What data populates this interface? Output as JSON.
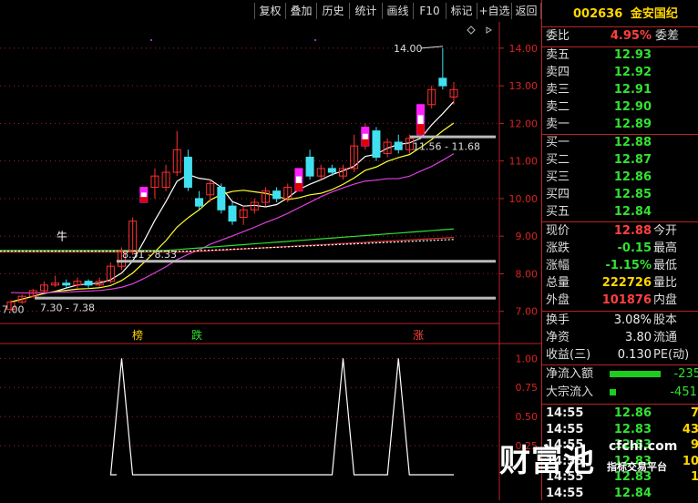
{
  "toolbar": {
    "buttons": [
      "复权",
      "叠加",
      "历史",
      "统计",
      "画线",
      "F10",
      "标记",
      "+自选",
      "返回"
    ]
  },
  "chart": {
    "price_axis": [
      "14.00",
      "13.00",
      "12.00",
      "11.00",
      "10.00",
      "9.00",
      "8.00",
      "7.00"
    ],
    "indicator_axis": [
      "1.00",
      "0.75",
      "0.50",
      "0.25"
    ],
    "annotations": {
      "high": "14.00",
      "box1": "11.56 - 11.68",
      "box2": "8.31 - 8.33",
      "box3": "7.30 - 7.38",
      "low": "7.00"
    },
    "markers": {
      "niu": "牛",
      "bang": "榜",
      "die": "跌",
      "zhang": "涨"
    },
    "candles": [
      {
        "o": 7.05,
        "c": 7.25,
        "h": 7.3,
        "l": 7.0,
        "type": "up"
      },
      {
        "o": 7.25,
        "c": 7.4,
        "h": 7.45,
        "l": 7.2,
        "type": "up"
      },
      {
        "o": 7.4,
        "c": 7.55,
        "h": 7.6,
        "l": 7.35,
        "type": "up"
      },
      {
        "o": 7.55,
        "c": 7.7,
        "h": 7.8,
        "l": 7.5,
        "type": "up"
      },
      {
        "o": 7.7,
        "c": 7.75,
        "h": 7.95,
        "l": 7.65,
        "type": "up"
      },
      {
        "o": 7.75,
        "c": 7.7,
        "h": 7.85,
        "l": 7.6,
        "type": "down"
      },
      {
        "o": 7.7,
        "c": 7.8,
        "h": 7.9,
        "l": 7.6,
        "type": "up"
      },
      {
        "o": 7.8,
        "c": 7.7,
        "h": 7.85,
        "l": 7.6,
        "type": "down"
      },
      {
        "o": 7.7,
        "c": 7.8,
        "h": 7.9,
        "l": 7.65,
        "type": "up"
      },
      {
        "o": 7.8,
        "c": 8.2,
        "h": 8.3,
        "l": 7.75,
        "type": "up"
      },
      {
        "o": 8.2,
        "c": 8.6,
        "h": 8.7,
        "l": 8.1,
        "type": "up"
      },
      {
        "o": 8.6,
        "c": 9.4,
        "h": 9.5,
        "l": 8.5,
        "type": "up"
      },
      {
        "o": 9.9,
        "c": 10.3,
        "h": 10.3,
        "l": 9.9,
        "type": "limit"
      },
      {
        "o": 10.3,
        "c": 10.6,
        "h": 10.8,
        "l": 10.0,
        "type": "up"
      },
      {
        "o": 10.3,
        "c": 10.7,
        "h": 10.9,
        "l": 10.2,
        "type": "up"
      },
      {
        "o": 10.7,
        "c": 11.3,
        "h": 11.8,
        "l": 10.6,
        "type": "up"
      },
      {
        "o": 11.1,
        "c": 10.3,
        "h": 11.3,
        "l": 10.2,
        "type": "down"
      },
      {
        "o": 10.0,
        "c": 9.8,
        "h": 10.2,
        "l": 9.7,
        "type": "down"
      },
      {
        "o": 10.1,
        "c": 10.4,
        "h": 10.5,
        "l": 9.9,
        "type": "up"
      },
      {
        "o": 10.3,
        "c": 9.7,
        "h": 10.4,
        "l": 9.6,
        "type": "down"
      },
      {
        "o": 9.8,
        "c": 9.4,
        "h": 9.9,
        "l": 9.3,
        "type": "down"
      },
      {
        "o": 9.5,
        "c": 9.7,
        "h": 9.8,
        "l": 9.3,
        "type": "up"
      },
      {
        "o": 9.7,
        "c": 9.9,
        "h": 10.0,
        "l": 9.6,
        "type": "up"
      },
      {
        "o": 9.9,
        "c": 10.2,
        "h": 10.3,
        "l": 9.8,
        "type": "up"
      },
      {
        "o": 10.2,
        "c": 10.0,
        "h": 10.3,
        "l": 9.9,
        "type": "down"
      },
      {
        "o": 10.0,
        "c": 10.3,
        "h": 10.4,
        "l": 9.9,
        "type": "up"
      },
      {
        "o": 10.2,
        "c": 10.8,
        "h": 10.8,
        "l": 10.2,
        "type": "limit"
      },
      {
        "o": 11.1,
        "c": 10.6,
        "h": 11.3,
        "l": 10.5,
        "type": "down"
      },
      {
        "o": 10.6,
        "c": 10.8,
        "h": 10.9,
        "l": 10.5,
        "type": "up"
      },
      {
        "o": 10.8,
        "c": 10.7,
        "h": 10.9,
        "l": 10.6,
        "type": "down"
      },
      {
        "o": 10.6,
        "c": 10.8,
        "h": 10.9,
        "l": 10.5,
        "type": "up"
      },
      {
        "o": 10.8,
        "c": 11.4,
        "h": 11.7,
        "l": 10.7,
        "type": "up"
      },
      {
        "o": 11.4,
        "c": 11.9,
        "h": 12.0,
        "l": 11.3,
        "type": "limit"
      },
      {
        "o": 11.8,
        "c": 11.1,
        "h": 11.9,
        "l": 11.0,
        "type": "down"
      },
      {
        "o": 11.2,
        "c": 11.5,
        "h": 11.6,
        "l": 11.1,
        "type": "up"
      },
      {
        "o": 11.5,
        "c": 11.3,
        "h": 11.7,
        "l": 11.2,
        "type": "down"
      },
      {
        "o": 11.3,
        "c": 11.6,
        "h": 11.7,
        "l": 11.2,
        "type": "up"
      },
      {
        "o": 11.7,
        "c": 12.5,
        "h": 12.5,
        "l": 11.7,
        "type": "limit"
      },
      {
        "o": 12.5,
        "c": 12.9,
        "h": 13.0,
        "l": 12.4,
        "type": "up"
      },
      {
        "o": 13.2,
        "c": 13.0,
        "h": 14.0,
        "l": 12.9,
        "type": "down"
      },
      {
        "o": 12.7,
        "c": 12.9,
        "h": 13.1,
        "l": 12.5,
        "type": "up"
      }
    ],
    "indicator_peaks": [
      {
        "index": 10,
        "value": 1.0
      },
      {
        "index": 30,
        "value": 1.0
      },
      {
        "index": 35,
        "value": 1.0
      }
    ]
  },
  "quote": {
    "code": "002636",
    "name": "金安国纪",
    "weibi_label": "委比",
    "weibi_value": "4.95%",
    "weicha_label": "委差",
    "sell": [
      {
        "label": "卖五",
        "price": "12.93"
      },
      {
        "label": "卖四",
        "price": "12.92"
      },
      {
        "label": "卖三",
        "price": "12.91"
      },
      {
        "label": "卖二",
        "price": "12.90"
      },
      {
        "label": "卖一",
        "price": "12.89"
      }
    ],
    "buy": [
      {
        "label": "买一",
        "price": "12.88"
      },
      {
        "label": "买二",
        "price": "12.87"
      },
      {
        "label": "买三",
        "price": "12.86"
      },
      {
        "label": "买四",
        "price": "12.85"
      },
      {
        "label": "买五",
        "price": "12.84"
      }
    ],
    "stats": [
      {
        "label": "现价",
        "value": "12.88",
        "color": "red",
        "right": "今开"
      },
      {
        "label": "涨跌",
        "value": "-0.15",
        "color": "green",
        "right": "最高"
      },
      {
        "label": "涨幅",
        "value": "-1.15%",
        "color": "green",
        "right": "最低"
      },
      {
        "label": "总量",
        "value": "222726",
        "color": "yellow",
        "right": "量比"
      },
      {
        "label": "外盘",
        "value": "101876",
        "color": "red",
        "right": "内盘"
      }
    ],
    "stats2": [
      {
        "label": "换手",
        "value": "3.08%",
        "right": "股本"
      },
      {
        "label": "净资",
        "value": "3.80",
        "right": "流通"
      },
      {
        "label": "收益(三)",
        "value": "0.130",
        "right": "PE(动)"
      }
    ],
    "flow": [
      {
        "label": "净流入额",
        "value": "-235",
        "bar": 0.8
      },
      {
        "label": "大宗流入",
        "value": "-451.",
        "bar": 0.1
      }
    ],
    "ticks": [
      {
        "time": "14:55",
        "price": "12.86",
        "color": "green",
        "vol": "7"
      },
      {
        "time": "14:55",
        "price": "12.83",
        "color": "green",
        "vol": "43"
      },
      {
        "time": "14:55",
        "price": "12.83",
        "color": "green",
        "vol": "9"
      },
      {
        "time": "14:55",
        "price": "12.83",
        "color": "green",
        "vol": "10"
      },
      {
        "time": "14:55",
        "price": "12.83",
        "color": "green",
        "vol": "1"
      },
      {
        "time": "14:55",
        "price": "12.84",
        "color": "green",
        "vol": ""
      }
    ]
  },
  "watermark": {
    "brand": "财富池",
    "site": "cfchi.com",
    "tagline": "指标交易平台"
  }
}
